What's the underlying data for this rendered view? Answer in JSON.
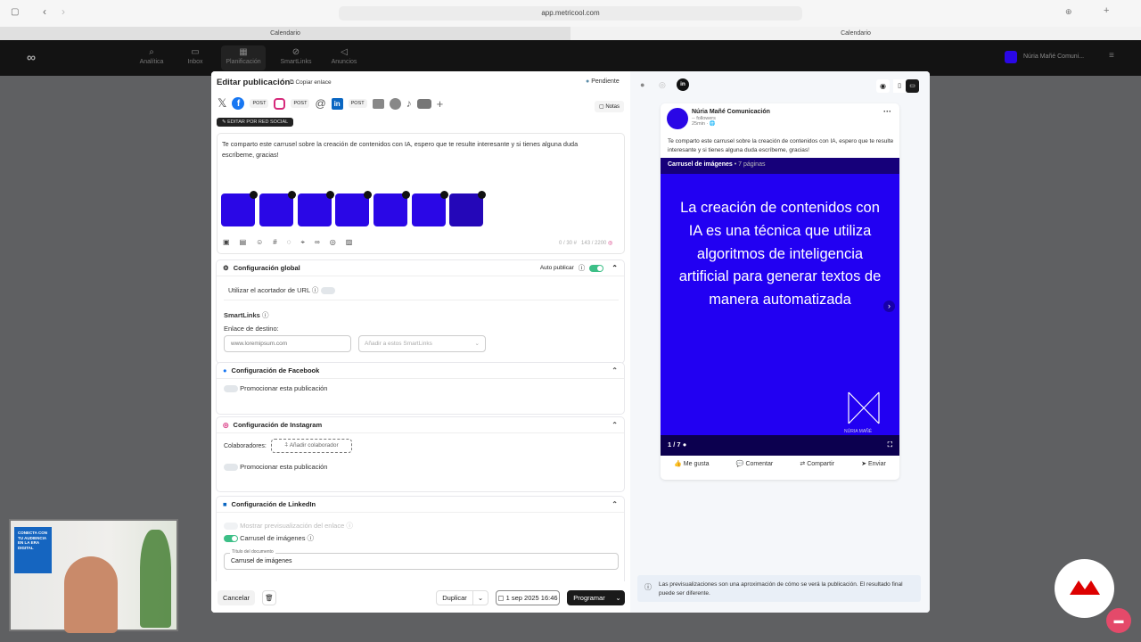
{
  "browser": {
    "url": "app.metricool.com",
    "tabs": [
      "Calendario",
      "Calendario"
    ]
  },
  "nav": {
    "items": [
      "Analítica",
      "Inbox",
      "Planificación",
      "SmartLinks",
      "Anuncios"
    ],
    "brand": "Núria Mañé Comuni..."
  },
  "editor": {
    "title": "Editar publicación",
    "copy_link": "Copiar enlace",
    "status": "Pendiente",
    "networks": [
      {
        "name": "X"
      },
      {
        "name": "Facebook",
        "type": "POST"
      },
      {
        "name": "Instagram",
        "type": "POST"
      },
      {
        "name": "Threads"
      },
      {
        "name": "LinkedIn",
        "type": "POST"
      },
      {
        "name": "Google Business"
      },
      {
        "name": "Pinterest"
      },
      {
        "name": "TikTok"
      },
      {
        "name": "YouTube"
      }
    ],
    "add": "+",
    "notes": "Notas",
    "edit_by_network": "EDITAR POR RED SOCIAL",
    "text": "Te comparto este carrusel sobre la creación de contenidos con IA, espero que te resulte interesante y si tienes alguna duda escríbeme, gracias!",
    "hashtag_count": "0 / 30",
    "char_count": "143 / 2200",
    "global": {
      "title": "Configuración global",
      "auto_publish": "Auto publicar",
      "auto_publish_on": true,
      "url_shortener": "Utilizar el acortador de URL",
      "smartlinks": "SmartLinks",
      "dest_label": "Enlace de destino:",
      "dest_placeholder": "www.loremipsum.com",
      "smartlinks_placeholder": "Añadir a estos SmartLinks"
    },
    "facebook": {
      "title": "Configuración de Facebook",
      "promote": "Promocionar esta publicación"
    },
    "instagram": {
      "title": "Configuración de Instagram",
      "collaborators": "Colaboradores:",
      "add_collaborator": "Añadir colaborador",
      "promote": "Promocionar esta publicación"
    },
    "linkedin": {
      "title": "Configuración de LinkedIn",
      "link_preview": "Mostrar previsualización del enlace",
      "carousel": "Carrusel de imágenes",
      "doc_title_label": "Título del documento",
      "doc_title": "Carrusel de imágenes"
    },
    "footer": {
      "cancel": "Cancelar",
      "duplicate": "Duplicar",
      "date": "1 sep 2025 16:46",
      "schedule": "Programar"
    }
  },
  "preview": {
    "author": "Núria Mañé Comunicación",
    "followers": "-- followers",
    "time": "25min ·",
    "text": "Te comparto este carrusel sobre la creación de contenidos con IA, espero que te resulte interesante y si tienes alguna duda escríbeme, gracias!",
    "carousel_title": "Carrusel de imágenes",
    "carousel_pages": "• 7 páginas",
    "slide_text": "La creación de contenidos con IA es una técnica que utiliza algoritmos de inteligencia artificial para generar textos de manera automatizada",
    "slide_brand": "NÚRIA MAÑÉ",
    "page": "1 / 7",
    "actions": [
      "Me gusta",
      "Comentar",
      "Compartir",
      "Enviar"
    ],
    "notice": "Las previsualizaciones son una aproximación de cómo se verá la publicación. El resultado final puede ser diferente."
  },
  "webcam": {
    "poster": "CONECTA CON TU AUDIENCIA EN LA ERA DIGITAL"
  }
}
